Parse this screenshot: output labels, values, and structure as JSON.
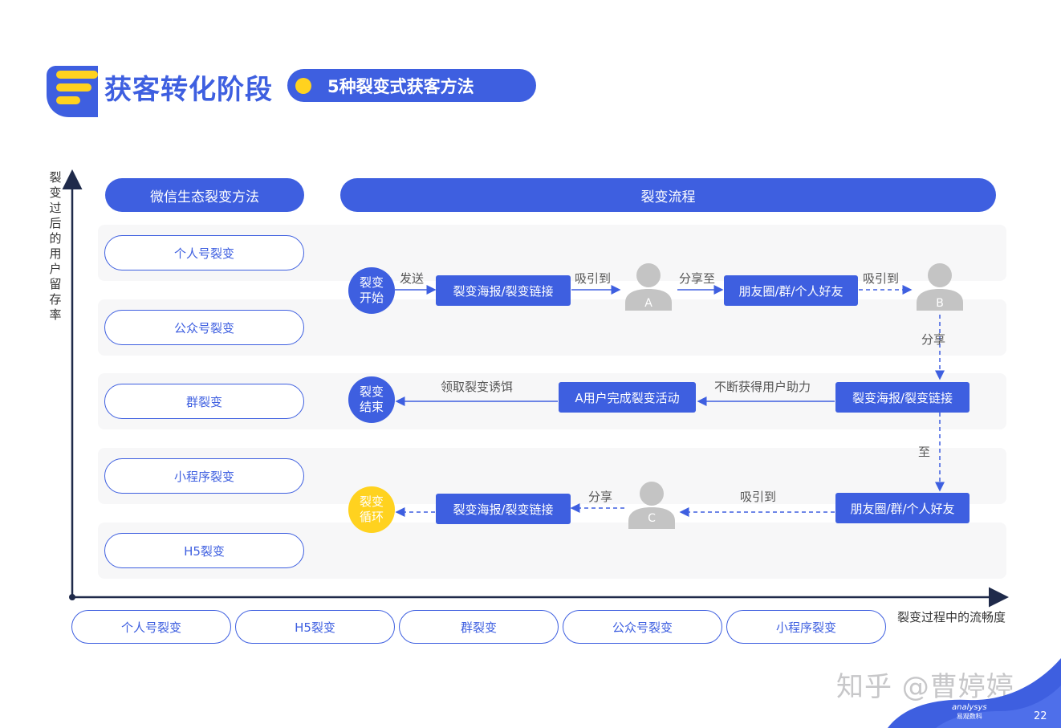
{
  "header": {
    "title": "获客转化阶段",
    "subtitle": "5种裂变式获客方法"
  },
  "axes": {
    "y_label": "裂变过后的用户留存率",
    "x_label": "裂变过程中的流畅度"
  },
  "columns": {
    "methods_header": "微信生态裂变方法",
    "flow_header": "裂变流程"
  },
  "methods_y_order": [
    "个人号裂变",
    "公众号裂变",
    "群裂变",
    "小程序裂变",
    "H5裂变"
  ],
  "methods_x_order": [
    "个人号裂变",
    "H5裂变",
    "群裂变",
    "公众号裂变",
    "小程序裂变"
  ],
  "flow": {
    "start": "裂变开始",
    "end": "裂变结束",
    "cycle": "裂变循环",
    "send": "发送",
    "poster_link": "裂变海报/裂变链接",
    "attract": "吸引到",
    "share_to": "分享至",
    "moments_groups_friends": "朋友圈/群/个人好友",
    "user_a": "A",
    "user_b": "B",
    "user_c": "C",
    "share_vertical": "分享",
    "to_vertical": "至",
    "continuous_help": "不断获得用户助力",
    "a_completes": "A用户完成裂变活动",
    "claim_bait": "领取裂变诱饵",
    "share": "分享"
  },
  "footer": {
    "watermark": "知乎 @曹婷婷",
    "brand": "analysys",
    "brand_cn": "易观数科",
    "page_number": "22"
  },
  "colors": {
    "primary": "#3e5fe0",
    "accent": "#ffd21f",
    "band": "#f7f7f8"
  }
}
